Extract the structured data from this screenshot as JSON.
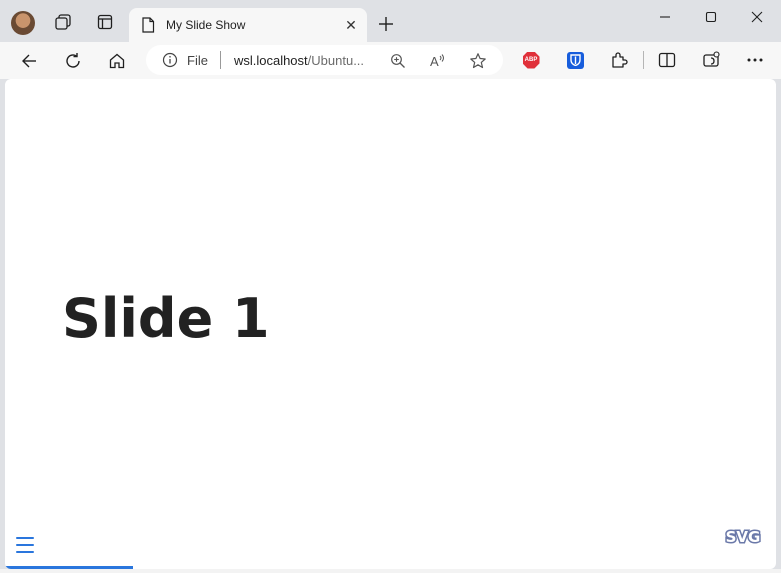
{
  "browser": {
    "tab": {
      "title": "My Slide Show",
      "close_symbol": "✕"
    },
    "address_bar": {
      "scheme_label": "File",
      "url_host": "wsl.localhost",
      "url_path": "/Ubuntu..."
    },
    "icons": [
      "profile-avatar",
      "workspaces-icon",
      "tab-actions-icon",
      "page-icon",
      "close-icon",
      "plus-icon",
      "minimize-icon",
      "maximize-icon",
      "window-close-icon",
      "back-icon",
      "refresh-icon",
      "home-icon",
      "info-icon",
      "zoom-icon",
      "read-aloud-icon",
      "favorite-star-icon",
      "adblock-plus-icon",
      "bitwarden-icon",
      "extensions-icon",
      "split-screen-icon",
      "browser-essentials-icon",
      "more-icon"
    ],
    "extensions": {
      "adblock_label": "ABP"
    }
  },
  "slide": {
    "title": "Slide 1",
    "progress_fraction": 0.166,
    "logo_text": "SVG"
  },
  "colors": {
    "accent": "#2a76dd",
    "title_text": "#222222",
    "frame": "#dfe1e5"
  }
}
